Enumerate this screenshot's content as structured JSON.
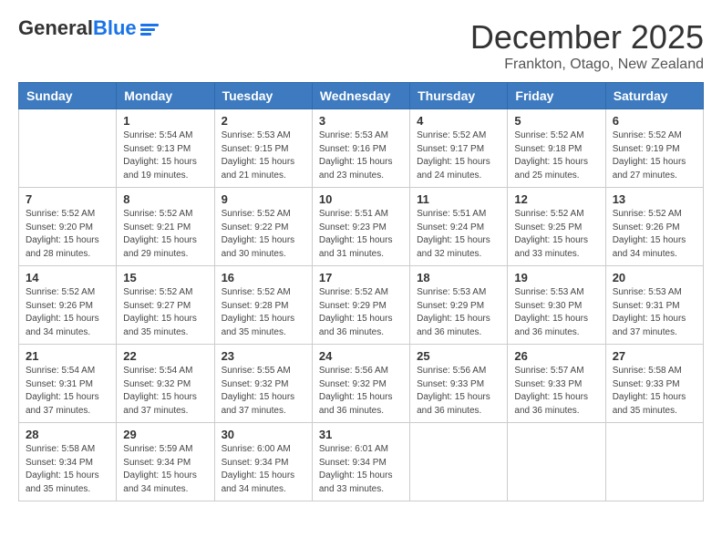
{
  "header": {
    "logo_general": "General",
    "logo_blue": "Blue",
    "month_title": "December 2025",
    "location": "Frankton, Otago, New Zealand"
  },
  "weekdays": [
    "Sunday",
    "Monday",
    "Tuesday",
    "Wednesday",
    "Thursday",
    "Friday",
    "Saturday"
  ],
  "weeks": [
    [
      {
        "day": "",
        "info": ""
      },
      {
        "day": "1",
        "info": "Sunrise: 5:54 AM\nSunset: 9:13 PM\nDaylight: 15 hours\nand 19 minutes."
      },
      {
        "day": "2",
        "info": "Sunrise: 5:53 AM\nSunset: 9:15 PM\nDaylight: 15 hours\nand 21 minutes."
      },
      {
        "day": "3",
        "info": "Sunrise: 5:53 AM\nSunset: 9:16 PM\nDaylight: 15 hours\nand 23 minutes."
      },
      {
        "day": "4",
        "info": "Sunrise: 5:52 AM\nSunset: 9:17 PM\nDaylight: 15 hours\nand 24 minutes."
      },
      {
        "day": "5",
        "info": "Sunrise: 5:52 AM\nSunset: 9:18 PM\nDaylight: 15 hours\nand 25 minutes."
      },
      {
        "day": "6",
        "info": "Sunrise: 5:52 AM\nSunset: 9:19 PM\nDaylight: 15 hours\nand 27 minutes."
      }
    ],
    [
      {
        "day": "7",
        "info": "Sunrise: 5:52 AM\nSunset: 9:20 PM\nDaylight: 15 hours\nand 28 minutes."
      },
      {
        "day": "8",
        "info": "Sunrise: 5:52 AM\nSunset: 9:21 PM\nDaylight: 15 hours\nand 29 minutes."
      },
      {
        "day": "9",
        "info": "Sunrise: 5:52 AM\nSunset: 9:22 PM\nDaylight: 15 hours\nand 30 minutes."
      },
      {
        "day": "10",
        "info": "Sunrise: 5:51 AM\nSunset: 9:23 PM\nDaylight: 15 hours\nand 31 minutes."
      },
      {
        "day": "11",
        "info": "Sunrise: 5:51 AM\nSunset: 9:24 PM\nDaylight: 15 hours\nand 32 minutes."
      },
      {
        "day": "12",
        "info": "Sunrise: 5:52 AM\nSunset: 9:25 PM\nDaylight: 15 hours\nand 33 minutes."
      },
      {
        "day": "13",
        "info": "Sunrise: 5:52 AM\nSunset: 9:26 PM\nDaylight: 15 hours\nand 34 minutes."
      }
    ],
    [
      {
        "day": "14",
        "info": "Sunrise: 5:52 AM\nSunset: 9:26 PM\nDaylight: 15 hours\nand 34 minutes."
      },
      {
        "day": "15",
        "info": "Sunrise: 5:52 AM\nSunset: 9:27 PM\nDaylight: 15 hours\nand 35 minutes."
      },
      {
        "day": "16",
        "info": "Sunrise: 5:52 AM\nSunset: 9:28 PM\nDaylight: 15 hours\nand 35 minutes."
      },
      {
        "day": "17",
        "info": "Sunrise: 5:52 AM\nSunset: 9:29 PM\nDaylight: 15 hours\nand 36 minutes."
      },
      {
        "day": "18",
        "info": "Sunrise: 5:53 AM\nSunset: 9:29 PM\nDaylight: 15 hours\nand 36 minutes."
      },
      {
        "day": "19",
        "info": "Sunrise: 5:53 AM\nSunset: 9:30 PM\nDaylight: 15 hours\nand 36 minutes."
      },
      {
        "day": "20",
        "info": "Sunrise: 5:53 AM\nSunset: 9:31 PM\nDaylight: 15 hours\nand 37 minutes."
      }
    ],
    [
      {
        "day": "21",
        "info": "Sunrise: 5:54 AM\nSunset: 9:31 PM\nDaylight: 15 hours\nand 37 minutes."
      },
      {
        "day": "22",
        "info": "Sunrise: 5:54 AM\nSunset: 9:32 PM\nDaylight: 15 hours\nand 37 minutes."
      },
      {
        "day": "23",
        "info": "Sunrise: 5:55 AM\nSunset: 9:32 PM\nDaylight: 15 hours\nand 37 minutes."
      },
      {
        "day": "24",
        "info": "Sunrise: 5:56 AM\nSunset: 9:32 PM\nDaylight: 15 hours\nand 36 minutes."
      },
      {
        "day": "25",
        "info": "Sunrise: 5:56 AM\nSunset: 9:33 PM\nDaylight: 15 hours\nand 36 minutes."
      },
      {
        "day": "26",
        "info": "Sunrise: 5:57 AM\nSunset: 9:33 PM\nDaylight: 15 hours\nand 36 minutes."
      },
      {
        "day": "27",
        "info": "Sunrise: 5:58 AM\nSunset: 9:33 PM\nDaylight: 15 hours\nand 35 minutes."
      }
    ],
    [
      {
        "day": "28",
        "info": "Sunrise: 5:58 AM\nSunset: 9:34 PM\nDaylight: 15 hours\nand 35 minutes."
      },
      {
        "day": "29",
        "info": "Sunrise: 5:59 AM\nSunset: 9:34 PM\nDaylight: 15 hours\nand 34 minutes."
      },
      {
        "day": "30",
        "info": "Sunrise: 6:00 AM\nSunset: 9:34 PM\nDaylight: 15 hours\nand 34 minutes."
      },
      {
        "day": "31",
        "info": "Sunrise: 6:01 AM\nSunset: 9:34 PM\nDaylight: 15 hours\nand 33 minutes."
      },
      {
        "day": "",
        "info": ""
      },
      {
        "day": "",
        "info": ""
      },
      {
        "day": "",
        "info": ""
      }
    ]
  ]
}
